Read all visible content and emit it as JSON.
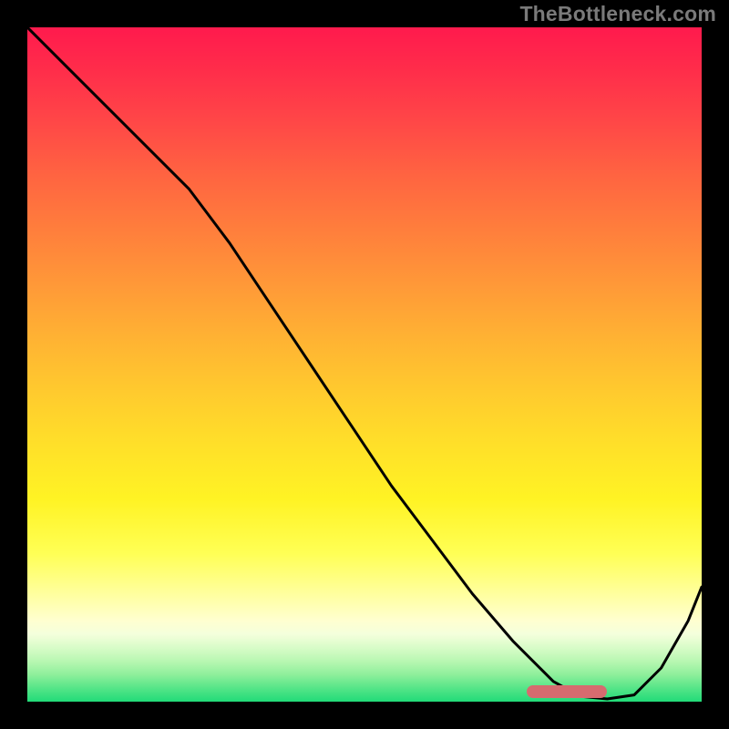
{
  "attribution": "TheBottleneck.com",
  "colors": {
    "background_outer": "#000000",
    "curve": "#000000",
    "marker": "#d66b6f",
    "gradient_top": "#ff1a4d",
    "gradient_mid": "#ffe029",
    "gradient_bottom": "#21db78"
  },
  "chart_data": {
    "type": "line",
    "title": "",
    "xlabel": "",
    "ylabel": "",
    "xlim": [
      0,
      100
    ],
    "ylim": [
      0,
      100
    ],
    "grid": false,
    "legend": false,
    "x": [
      0,
      6,
      12,
      18,
      24,
      30,
      36,
      42,
      48,
      54,
      60,
      66,
      72,
      78,
      82,
      86,
      90,
      94,
      98,
      100
    ],
    "values": [
      100,
      94,
      88,
      82,
      76,
      68,
      59,
      50,
      41,
      32,
      24,
      16,
      9,
      3,
      0.8,
      0.4,
      1.0,
      5,
      12,
      17
    ],
    "marker_range_x": [
      74,
      86
    ],
    "annotations": []
  }
}
